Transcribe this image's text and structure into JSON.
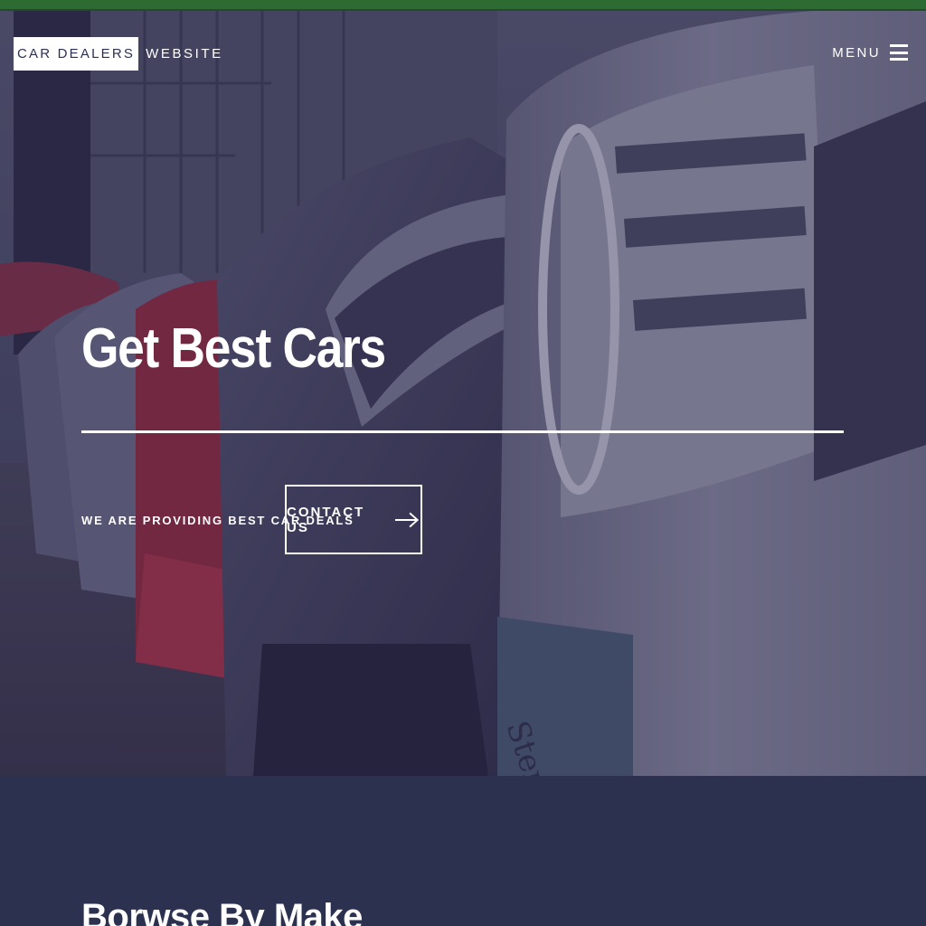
{
  "header": {
    "logo_boxed": "CAR DEALERS",
    "logo_rest": "WEBSITE",
    "menu_label": "MENU"
  },
  "hero": {
    "title": "Get Best Cars",
    "tagline": "WE ARE PROVIDING BEST CAR DEALS",
    "cta_label": "CONTACT US",
    "background_image": "photo of a row of parked cars, front grilles close-up",
    "icons": {
      "menu": "hamburger-icon",
      "cta": "arrow-right-icon"
    }
  },
  "browse": {
    "title": "Borwse By Make"
  },
  "colors": {
    "topbar": "#2e6b32",
    "hero_overlay": "#2c2652",
    "section_bg": "#2c3150",
    "text": "#ffffff"
  }
}
